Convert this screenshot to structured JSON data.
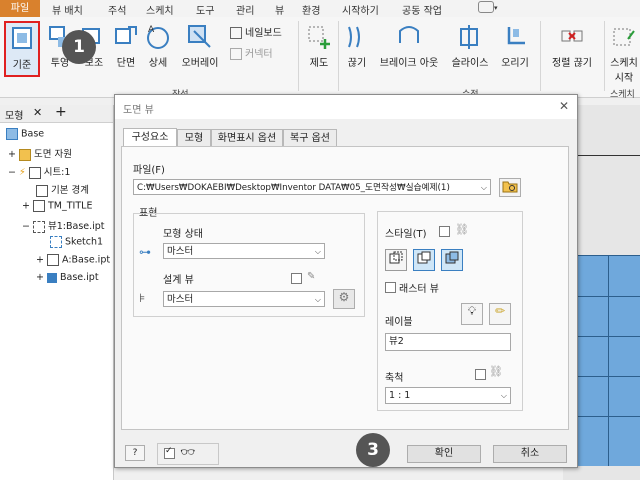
{
  "menu": {
    "items": [
      "파일",
      "뷰 배치",
      "주석",
      "스케치",
      "도구",
      "관리",
      "뷰",
      "환경",
      "시작하기",
      "공동 작업"
    ]
  },
  "ribbon": {
    "buttons": {
      "base": "기준",
      "projected": "투영",
      "aux": "보조",
      "section": "단면",
      "detail": "상세",
      "overlay": "오버레이",
      "nailboard": "네일보드",
      "connector": "커넥터",
      "draft": "제도",
      "break_out": "끊기",
      "break_out2": "브레이크 아웃",
      "slice": "슬라이스",
      "crop": "오리기",
      "align": "정렬 끊기",
      "start_sketch": "스케치",
      "start_sketch2": "시작"
    },
    "groups": {
      "create": "작성",
      "modify": "수정",
      "sketch": "스케치"
    }
  },
  "browser": {
    "tab_label": "모형",
    "tree": {
      "root": "Base",
      "resources": "도면 자원",
      "sheet": "시트:1",
      "border": "기본 경계",
      "title": "TM_TITLE",
      "view": "뷰1:Base.ipt",
      "sketch": "Sketch1",
      "a_base": "A:Base.ipt",
      "base_ipt": "Base.ipt"
    }
  },
  "dialog": {
    "title": "도면 뷰",
    "close": "✕",
    "tabs": [
      "구성요소",
      "모형",
      "화면표시 옵션",
      "복구 옵션"
    ],
    "file_label": "파일(F)",
    "file_path": "C:₩Users₩DOKAEBI₩Desktop₩Inventor DATA₩05_도면작성₩실습예제(1)",
    "representation_label": "표현",
    "model_state_label": "모형 상태",
    "model_state_value": "마스터",
    "design_view_label": "설계 뷰",
    "design_view_value": "마스터",
    "style_label": "스타일(T)",
    "raster_label": "래스터 뷰",
    "label_label": "레이블",
    "label_value": "뷰2",
    "scale_label": "축척",
    "scale_value": "1 : 1",
    "ok": "확인",
    "cancel": "취소",
    "help": "?"
  },
  "callouts": [
    "1",
    "3"
  ],
  "colors": {
    "file_menu": "#d9812d",
    "sheet_blue": "#6fa8dc",
    "callout_red": "#e02020",
    "style_active": "#cfe6f7"
  }
}
